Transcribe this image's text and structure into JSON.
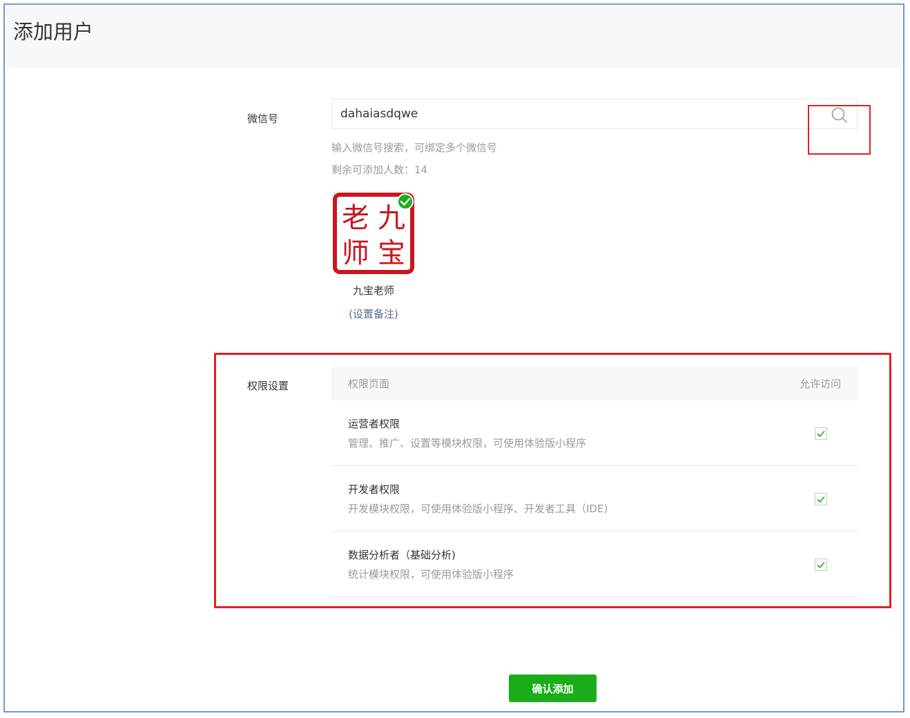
{
  "page": {
    "title": "添加用户"
  },
  "wechat": {
    "label": "微信号",
    "value": "dahaiasdqwe",
    "hint": "输入微信号搜索，可绑定多个微信号",
    "remaining_label": "剩余可添加人数：",
    "remaining_count": "14"
  },
  "user": {
    "avatar_chars": [
      "老",
      "九",
      "师",
      "宝"
    ],
    "name": "九宝老师",
    "remark_link": "(设置备注)"
  },
  "permissions": {
    "label": "权限设置",
    "header_page": "权限页面",
    "header_access": "允许访问",
    "rows": [
      {
        "title": "运营者权限",
        "desc": "管理、推广、设置等模块权限，可使用体验版小程序",
        "checked": true
      },
      {
        "title": "开发者权限",
        "desc": "开发模块权限，可使用体验版小程序、开发者工具（IDE)",
        "checked": true
      },
      {
        "title": "数据分析者（基础分析)",
        "desc": "统计模块权限，可使用体验版小程序",
        "checked": true
      }
    ]
  },
  "actions": {
    "confirm": "确认添加"
  },
  "colors": {
    "accent": "#1aad19",
    "link": "#576b95",
    "highlight": "#e02020",
    "stamp": "#c8171e"
  },
  "icons": {
    "search": "search-icon",
    "check": "check-icon",
    "verified": "verified-badge-icon"
  }
}
